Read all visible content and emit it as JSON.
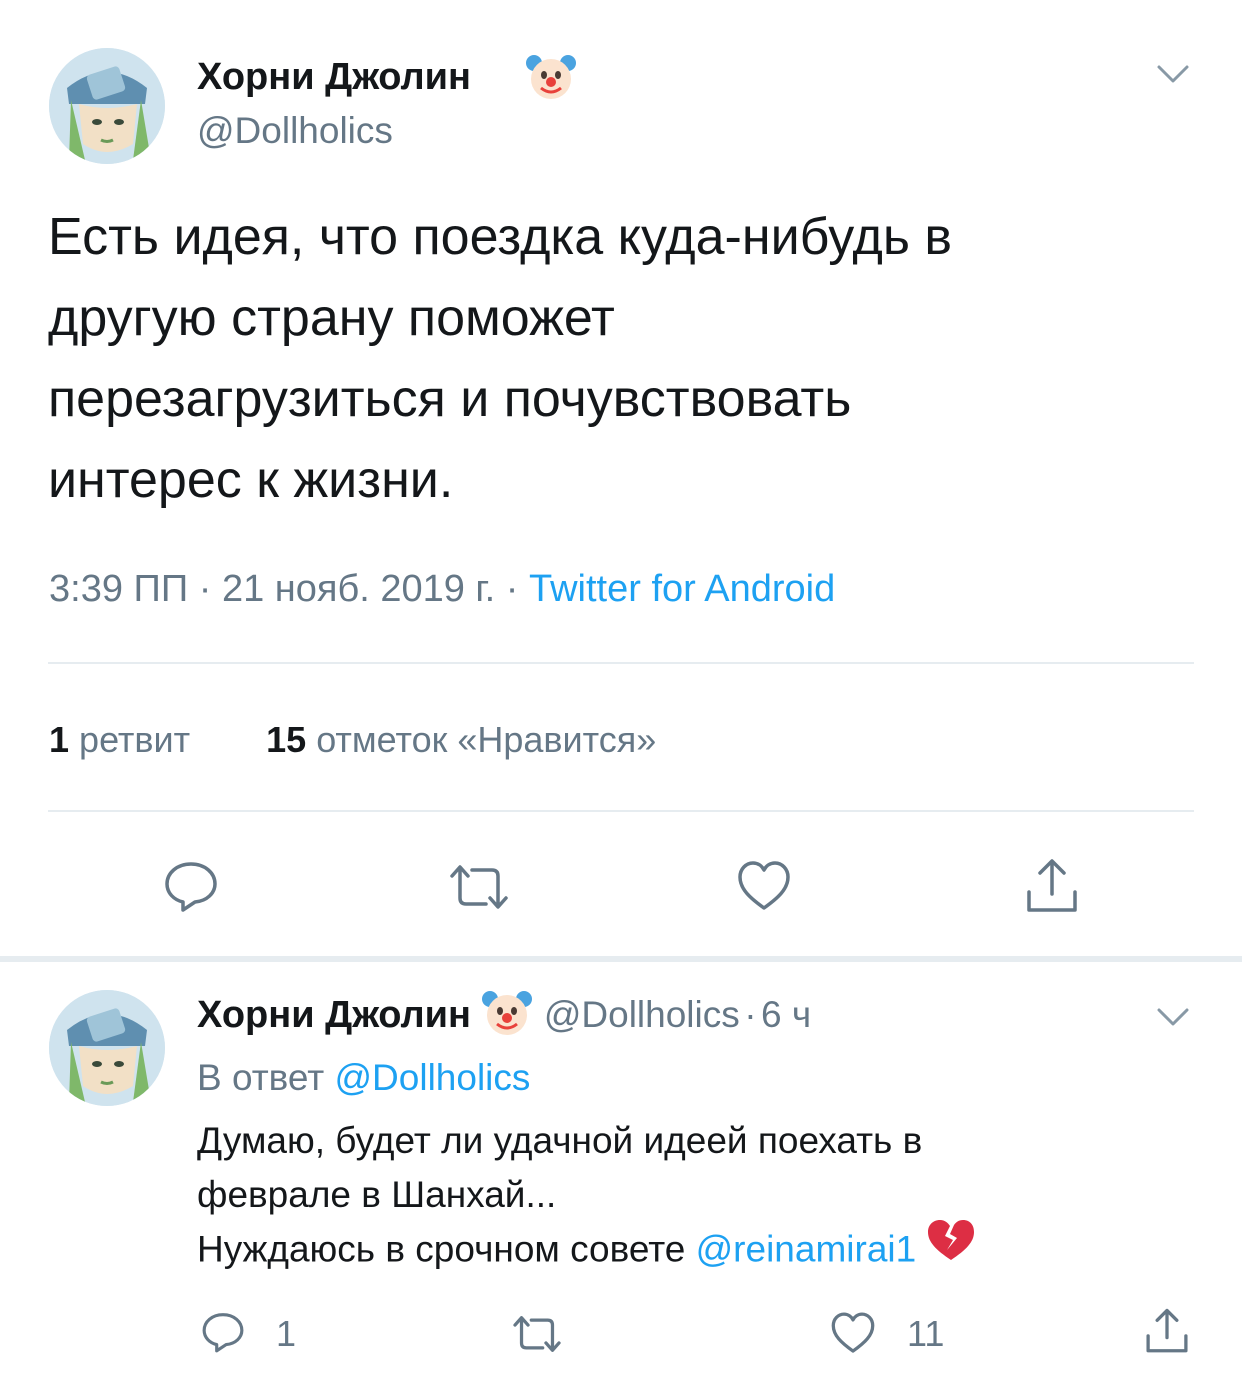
{
  "tweet": {
    "author_name": "Хорни Джолин",
    "author_handle": "@Dollholics",
    "author_emoji": "clown-face-emoji",
    "text_lines": [
      "Есть идея, что поездка куда-нибудь в",
      "другую страну поможет",
      "перезагрузиться и почувствовать",
      "интерес к жизни."
    ],
    "time": "3:39 ПП",
    "date": "21 нояб. 2019 г.",
    "separator": "·",
    "source": "Twitter for Android",
    "retweets_count": "1",
    "retweets_label": "ретвит",
    "likes_count": "15",
    "likes_label": "отметок «Нравится»",
    "actions": [
      "reply-icon",
      "retweet-icon",
      "like-icon",
      "share-icon"
    ]
  },
  "reply": {
    "author_name": "Хорни Джолин",
    "author_handle": "@Dollholics",
    "dot": "·",
    "time_ago": "6 ч",
    "reply_to_prefix": "В ответ",
    "reply_to_handle": "@Dollholics",
    "text_line1": "Думаю, будет ли удачной идеей поехать в",
    "text_line2": "феврале в Шанхай...",
    "text_line3_prefix": "Нуждаюсь в срочном совете",
    "mention": "@reinamirai1",
    "trailing_emoji": "broken-heart-emoji",
    "reply_count": "1",
    "like_count": "11"
  },
  "colors": {
    "accent": "#1da1f2",
    "secondary_text": "#657786",
    "divider": "#e6ecf0"
  }
}
